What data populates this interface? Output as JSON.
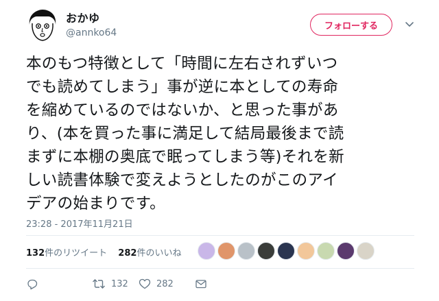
{
  "user": {
    "display_name": "おかゆ",
    "screen_name": "@annko64",
    "follow_label": "フォローする"
  },
  "tweet": {
    "lines": [
      "本のもつ特徴として「時間に左右されずいつ",
      "でも読めてしまう」事が逆に本としての寿命",
      "を縮めているのではないか、と思った事があ",
      "り、(本を買った事に満足して結局最後まで読",
      "まずに本棚の奥底で眠ってしまう等)それを新",
      "しい読書体験で変えようとしたのがこのアイ",
      "デアの始まりです。"
    ],
    "timestamp": "23:28 - 2017年11月21日"
  },
  "stats": {
    "retweets_count": "132",
    "retweets_label": "件のリツイート",
    "likes_count": "282",
    "likes_label": "件のいいね"
  },
  "actions": {
    "reply_icon": "reply-icon",
    "retweet_count": "132",
    "like_count": "282",
    "dm_icon": "envelope-icon"
  },
  "colors": {
    "accent": "#e0245e",
    "text": "#14171a",
    "muted": "#657786",
    "divider": "#e6ecf0"
  },
  "likers": [
    {
      "icon": "liker-avatar-1",
      "color": "#c9b7e8"
    },
    {
      "icon": "liker-avatar-2",
      "color": "#e0956a"
    },
    {
      "icon": "liker-avatar-3",
      "color": "#b9c1c8"
    },
    {
      "icon": "liker-avatar-4",
      "color": "#3a3d3a"
    },
    {
      "icon": "liker-avatar-5",
      "color": "#2a3550"
    },
    {
      "icon": "liker-avatar-6",
      "color": "#f2c79a"
    },
    {
      "icon": "liker-avatar-7",
      "color": "#c8d9b0"
    },
    {
      "icon": "liker-avatar-8",
      "color": "#5b3a6e"
    },
    {
      "icon": "liker-avatar-9",
      "color": "#d9d4c8"
    }
  ]
}
